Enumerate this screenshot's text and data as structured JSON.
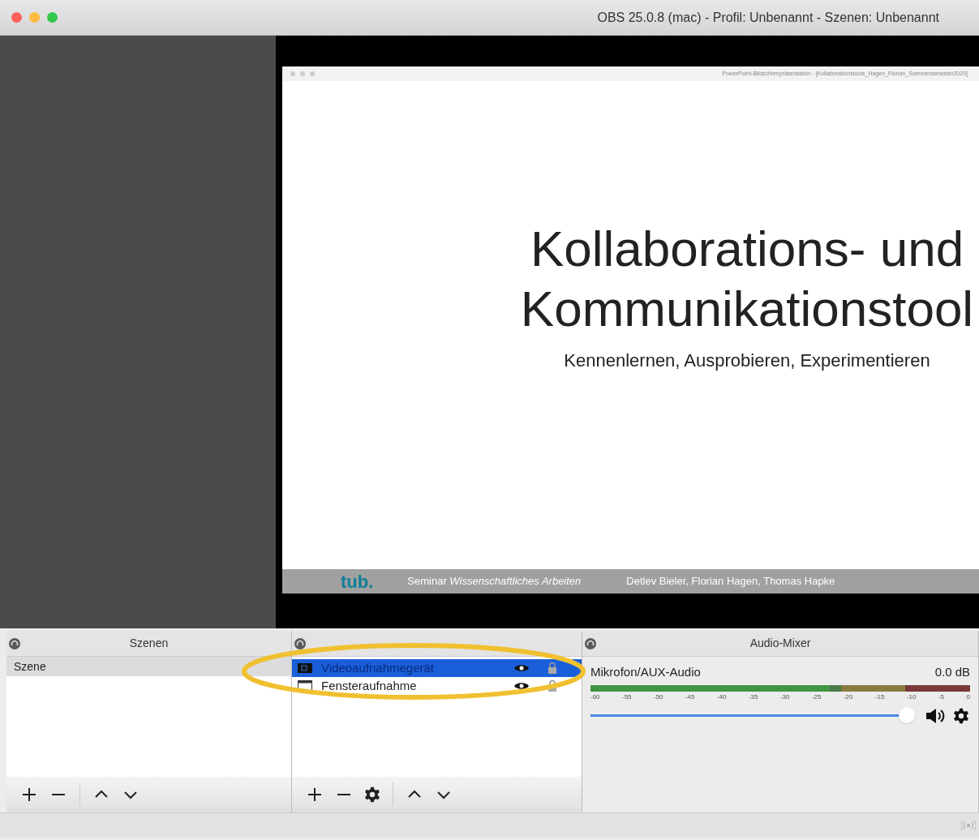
{
  "window": {
    "title": "OBS 25.0.8 (mac) - Profil: Unbenannt - Szenen: Unbenannt"
  },
  "preview": {
    "window_title": "PowerPoint-Bildschirmpräsentation - [Kollaborationstools_Hagen_Florian_Sommersemester2020]",
    "slide": {
      "title_lines": [
        "Kollaborations- und",
        "Kommunikationstool"
      ],
      "subtitle": "Kennenlernen, Ausprobieren, Experimentieren",
      "logo": "tub.",
      "seminar": "Seminar *Wissenschaftliches Arbeiten*",
      "authors": "Detlev Bieler, Florian Hagen, Thomas Hapke"
    }
  },
  "scenes": {
    "title": "Szenen",
    "items": [
      {
        "label": "Szene",
        "selected": true
      }
    ],
    "toolbar": [
      {
        "kind": "add"
      },
      {
        "kind": "remove"
      },
      {
        "kind": "sep"
      },
      {
        "kind": "up"
      },
      {
        "kind": "down"
      }
    ]
  },
  "sources": {
    "items": [
      {
        "label": "Videoaufnahmegerät",
        "kind": "camera",
        "selected": true
      },
      {
        "label": "Fensteraufnahme",
        "kind": "window",
        "selected": false
      }
    ],
    "toolbar": [
      {
        "kind": "add"
      },
      {
        "kind": "remove"
      },
      {
        "kind": "settings"
      },
      {
        "kind": "sep"
      },
      {
        "kind": "up"
      },
      {
        "kind": "down"
      }
    ]
  },
  "mixer": {
    "title": "Audio-Mixer",
    "channels": [
      {
        "name": "Mikrofon/AUX-Audio",
        "reading": "0.0 dB",
        "level": 0.63,
        "volume": {
          "level": 1
        },
        "ticks": [
          "-60",
          "-55",
          "-50",
          "-45",
          "-40",
          "-35",
          "-30",
          "-25",
          "-20",
          "-15",
          "-10",
          "-5",
          "0"
        ]
      }
    ]
  },
  "annotation": {
    "kind": "ellipse",
    "color": "#f0c030"
  }
}
